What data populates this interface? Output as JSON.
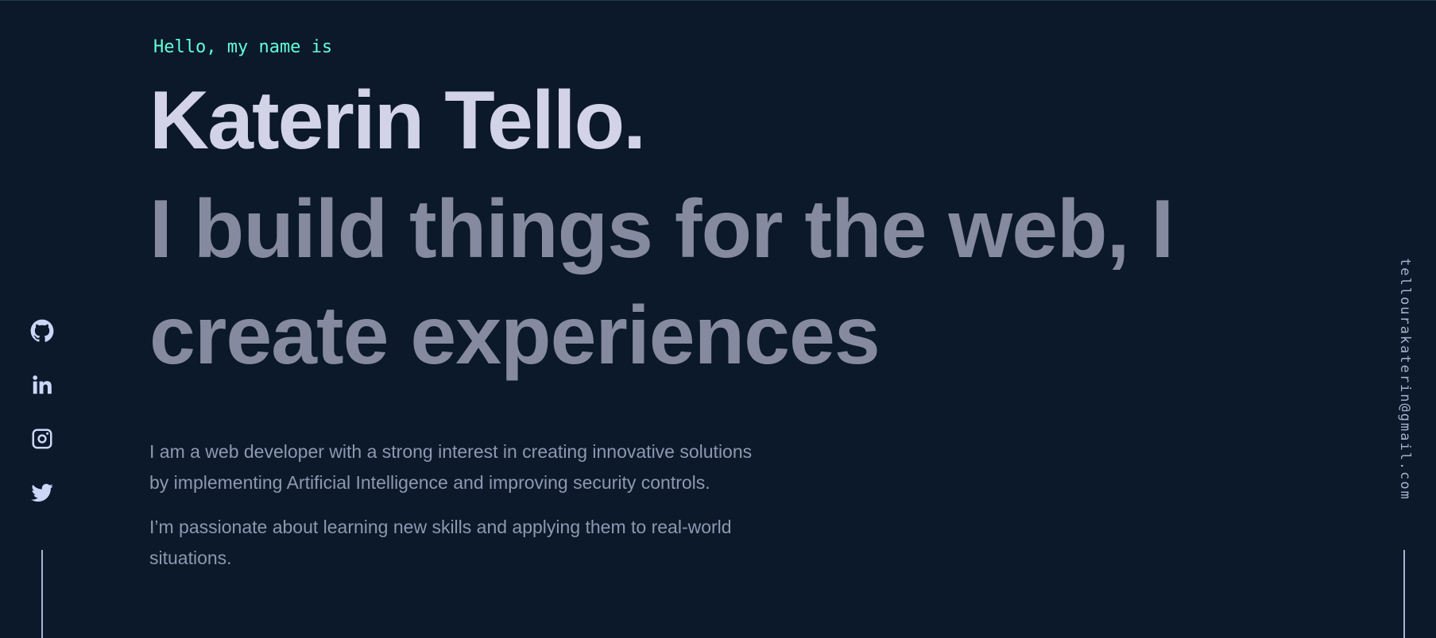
{
  "hero": {
    "greeting": "Hello, my name is",
    "name": "Katerin Tello.",
    "tagline": "I build things for the web, I create experiences",
    "bio_paragraph_1": "I am a web developer with a strong interest in creating innovative solutions by implementing Artificial Intelligence and improving security controls.",
    "bio_paragraph_2": "I’m passionate about learning new skills and applying them to real-world situations."
  },
  "social": {
    "items": [
      {
        "name": "GitHub",
        "icon": "github-icon"
      },
      {
        "name": "LinkedIn",
        "icon": "linkedin-icon"
      },
      {
        "name": "Instagram",
        "icon": "instagram-icon"
      },
      {
        "name": "Twitter",
        "icon": "twitter-icon"
      }
    ]
  },
  "email": {
    "address": "tellourakaterin@gmail.com"
  },
  "colors": {
    "background": "#0b192a",
    "accent": "#64ffda",
    "name": "#d2d3e6",
    "tagline": "#858aa0",
    "body_text": "#8f97b1",
    "rail": "#a8b2d1"
  }
}
